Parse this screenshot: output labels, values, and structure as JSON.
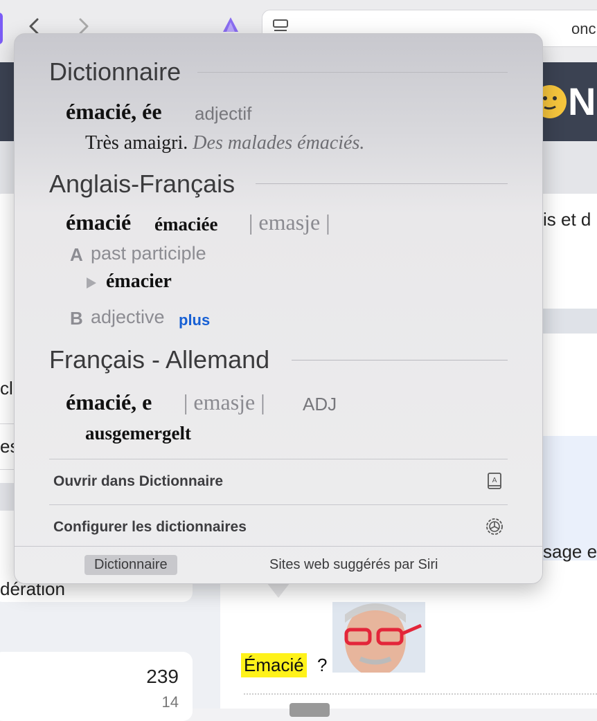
{
  "browser": {
    "back_icon": "chevron-left-icon",
    "forward_icon": "chevron-right-icon",
    "url_fragment": "onc"
  },
  "page_behind": {
    "header_logo_letter": "N",
    "text_fragments": {
      "right_1": "is et d",
      "left_1": "cl",
      "left_2": "es",
      "right_2": "sage e",
      "left_3": "dération"
    },
    "counts": {
      "big": "239",
      "small": "14"
    },
    "highlighted_word": "Émacié",
    "question_mark": "?"
  },
  "popover": {
    "sections": [
      {
        "title": "Dictionnaire",
        "headword": "émacié, ée",
        "part_of_speech": "adjectif",
        "definition": "Très amaigri.",
        "example": "Des malades émaciés."
      },
      {
        "title": "Anglais-Français",
        "headword": "émacié",
        "headword_feminine": "émaciée",
        "phonetic": "| emasje |",
        "senses": [
          {
            "letter": "A",
            "label": "past participle",
            "ref": "émacier"
          },
          {
            "letter": "B",
            "label": "adjective",
            "more": "plus"
          }
        ]
      },
      {
        "title": "Français - Allemand",
        "headword": "émacié, e",
        "phonetic": "| emasje |",
        "tag": "ADJ",
        "translation": "ausgemergelt"
      }
    ],
    "actions": [
      {
        "label": "Ouvrir dans Dictionnaire",
        "icon": "dictionary-book-icon"
      },
      {
        "label": "Configurer les dictionnaires",
        "icon": "gear-icon"
      }
    ],
    "footer_tabs": [
      {
        "label": "Dictionnaire",
        "active": true
      },
      {
        "label": "Sites web suggérés par Siri",
        "active": false
      }
    ]
  },
  "colors": {
    "accent_link": "#1760d4",
    "highlight": "#fff21a",
    "site_header": "#3b4252"
  }
}
